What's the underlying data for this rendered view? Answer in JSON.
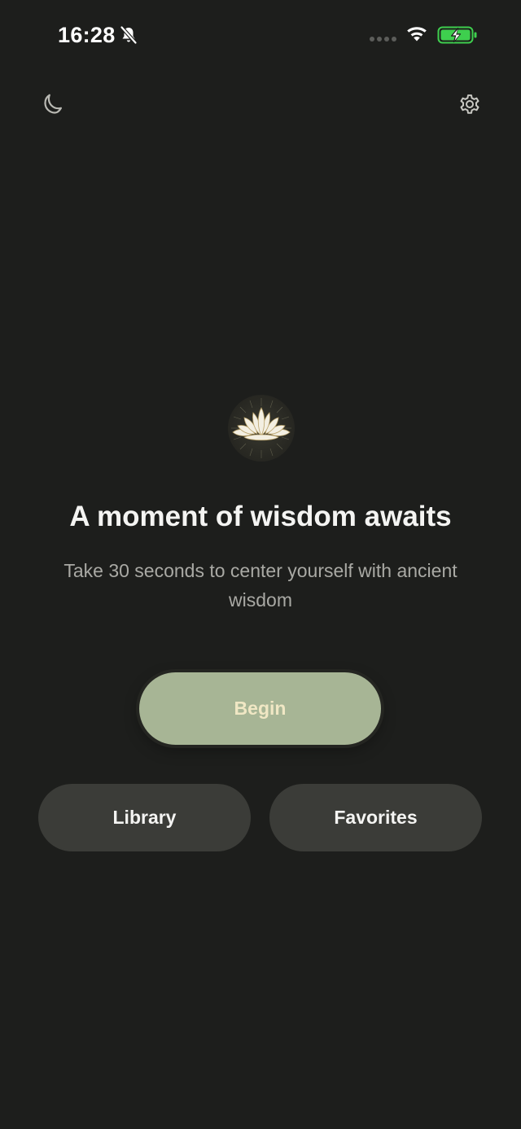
{
  "status_bar": {
    "time": "16:28",
    "icons": [
      "bell-slash-icon",
      "cellular-signal-icon",
      "wifi-icon",
      "battery-charging-icon"
    ],
    "battery_color": "#3ecf4e"
  },
  "top_bar": {
    "left_icon": "moon-icon",
    "right_icon": "gear-icon"
  },
  "hero": {
    "icon": "lotus-icon",
    "title": "A moment of wisdom awaits",
    "subtitle": "Take 30 seconds to center yourself with ancient wisdom"
  },
  "actions": {
    "begin_label": "Begin",
    "library_label": "Library",
    "favorites_label": "Favorites"
  },
  "colors": {
    "background": "#1d1e1c",
    "primary_button": "#a7b595",
    "primary_button_text": "#f0e7c4",
    "secondary_button": "#3b3c38",
    "text": "#f4f4f2",
    "muted_text": "#a9a9a4"
  }
}
